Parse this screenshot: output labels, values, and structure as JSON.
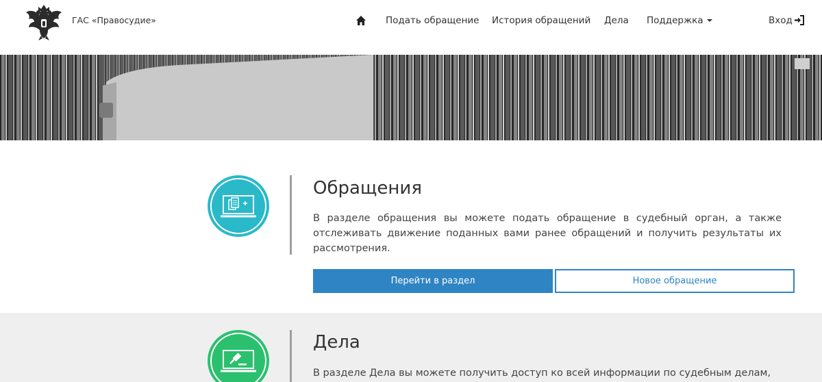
{
  "header": {
    "brand": "ГАС «Правосудие»",
    "nav": [
      {
        "label": "Подать обращение"
      },
      {
        "label": "История обращений"
      },
      {
        "label": "Дела"
      },
      {
        "label": "Поддержка"
      }
    ],
    "login": "Вход"
  },
  "sections": [
    {
      "title": "Обращения",
      "text": "В разделе обращения вы можете подать обращение в судебный орган, а также отслеживать движение поданных вами ранее обращений и получить результаты их рассмотрения.",
      "primary_button": "Перейти в раздел",
      "secondary_button": "Новое обращение",
      "icon_color": "#29b9c9"
    },
    {
      "title": "Дела",
      "text": "В разделе Дела вы можете получить доступ ко всей информации по судебным делам,",
      "icon_color": "#2bc06e"
    }
  ],
  "colors": {
    "accent": "#2f84c4"
  }
}
